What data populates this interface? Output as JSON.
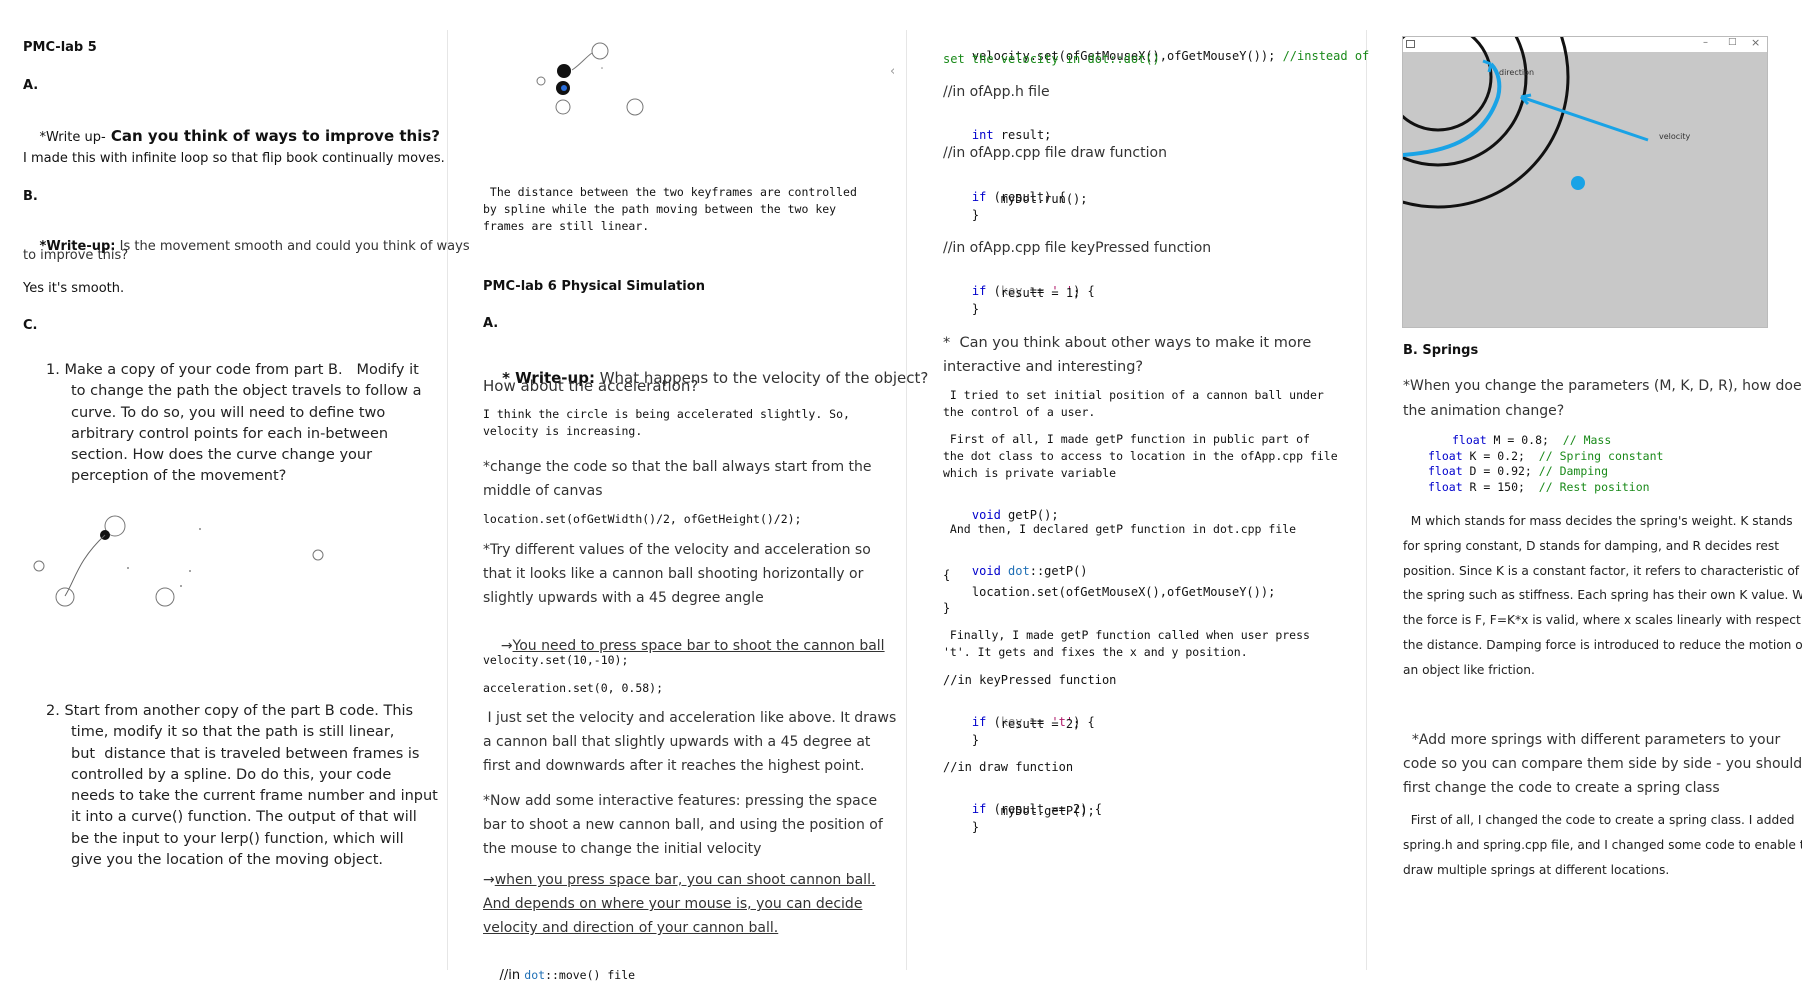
{
  "col1": {
    "title": "PMC-lab 5",
    "a_label": "A.",
    "a_writeup_prefix": "*Write up-",
    "a_writeup_q": " Can you think of ways to improve this?",
    "a_answer": "I made this with infinite loop so that flip book continually moves.",
    "b_label": "B.",
    "b_writeup_prefix": "*Write-up:",
    "b_writeup_q_line1": " Is the movement smooth and could you think of ways",
    "b_writeup_q_line2": "to improve this?",
    "b_answer": "Yes it's smooth.",
    "c_label": "C.",
    "item1_lines": [
      "1. Make a copy of your code from part B.   Modify it",
      "to change the path the object travels to follow a",
      "curve. To do so, you will need to define two",
      "arbitrary control points for each in-between",
      "section. How does the curve change your",
      "perception of the movement?"
    ],
    "item2_lines": [
      "2. Start from another copy of the part B code. This",
      "time, modify it so that the path is still linear,",
      "but  distance that is traveled between frames is",
      "controlled by a spline. Do do this, your code",
      "needs to take the current frame number and input",
      "it into a curve() function. The output of that will",
      "be the input to your lerp() function, which will",
      "give you the location of the moving object."
    ]
  },
  "col2": {
    "spline_note": [
      " The distance between the two keyframes are controlled",
      "by spline while the path moving between the two key",
      "frames are still linear."
    ],
    "lab6_title": "PMC-lab 6 Physical Simulation",
    "a_label": "A.",
    "q1_prefix": "* Write-up:",
    "q1_line1": " What happens to the velocity of the object?",
    "q1_line2": "How about the acceleration?",
    "a1_lines": [
      "I think the circle is being accelerated slightly. So,",
      "velocity is increasing."
    ],
    "q2_lines": [
      "*change the code so that the ball always start from the",
      "middle of canvas"
    ],
    "code_location": "location.set(ofGetWidth()/2, ofGetHeight()/2);",
    "q3_lines": [
      "*Try different values of the velocity and acceleration so",
      "that it looks like a cannon ball shooting horizontally or",
      "slightly upwards with a 45 degree angle"
    ],
    "arrow_note": "You need to press space bar to shoot the cannon ball",
    "code_velocity": "velocity.set(10,-10);",
    "code_accel": "acceleration.set(0, 0.58);",
    "a3_lines": [
      " I just set the velocity and acceleration like above. It draws",
      "a cannon ball that slightly upwards with a 45 degree at",
      "first and downwards after it reaches the highest point."
    ],
    "q4_lines": [
      "*Now add some interactive features: pressing the space",
      "bar to shoot a new cannon ball, and using the position of",
      "the mouse to change the initial velocity"
    ],
    "a4_lines": [
      "when you press space bar, you can shoot cannon ball.",
      "And depends on where your mouse is, you can decide",
      "velocity and direction of your cannon ball."
    ],
    "code_dotmove_prefix": "//in ",
    "code_dotmove_cls": "dot",
    "code_dotmove_rest": "::move() file"
  },
  "col3": {
    "code_vel_a": "velocity.set(ofGetMouseX(),ofGetMouseY()); ",
    "code_vel_cmt_a": "//instead of",
    "code_vel_cmt_b": "set the velocity in dot::dot()",
    "c_apph": "//in ofApp.h file",
    "int_kw": "int",
    "int_rest": " result;",
    "c_appcpp_draw": "//in ofApp.cpp file draw function",
    "if1_line1_kw": "if",
    "if1_line1_rest": " (result) {",
    "if1_line2": "        myDot.run();",
    "if1_line3": "    }",
    "c_keypressed": "//in ofApp.cpp file keyPressed function",
    "if2_kw": "if",
    "if2_key": "key",
    "if2_mid": " == ",
    "if2_str": "' '",
    "if2_end": ") {",
    "if2_line2": "        result = 1;",
    "if2_line3": "    }",
    "q_lines": [
      "*  Can you think about other ways to make it more",
      "interactive and interesting?"
    ],
    "a_lines1": [
      " I tried to set initial position of a cannon ball under",
      "the control of a user."
    ],
    "a_lines2": [
      " First of all, I made getP function in public part of",
      "the dot class to access to location in the ofApp.cpp file",
      "which is private variable"
    ],
    "void1_kw": "void",
    "void1_rest": " getP();",
    "a_line3": " And then, I declared getP function in dot.cpp file",
    "void2_kw": "void",
    "void2_cls": " dot",
    "void2_rest": "::getP()",
    "brace_open": "{",
    "getp_body": "    location.set(ofGetMouseX(),ofGetMouseY());",
    "brace_close": "}",
    "a_lines4": [
      " Finally, I made getP function called when user press",
      "'t'. It gets and fixes the x and y position."
    ],
    "c_keypressed2": "//in keyPressed function",
    "if3_kw": "if",
    "if3_key": "key",
    "if3_mid": " == ",
    "if3_str": "'t'",
    "if3_end": ") {",
    "if3_line2": "        result = 2;",
    "if3_line3": "    }",
    "c_draw": "//in draw function",
    "if4_kw": "if",
    "if4_rest": " (result == 2) {",
    "if4_line2": "        myDot.getP();",
    "if4_line3": "    }"
  },
  "col4": {
    "window_controls": [
      "–",
      "□",
      "×"
    ],
    "label_direction": "direction",
    "label_velocity": "velocity",
    "b_title": "B. Springs",
    "q_lines": [
      "*When you change the parameters (M, K, D, R), how does",
      "the animation change?"
    ],
    "code_lines": [
      {
        "kw": "float",
        "rest": " M = 0.8;  ",
        "cmt": "// Mass"
      },
      {
        "kw": "float",
        "rest": " K = 0.2;  ",
        "cmt": "// Spring constant"
      },
      {
        "kw": "float",
        "rest": " D = 0.92; ",
        "cmt": "// Damping"
      },
      {
        "kw": "float",
        "rest": " R = 150;  ",
        "cmt": "// Rest position"
      }
    ],
    "a_lines": [
      "  M which stands for mass decides the spring's weight. K stands",
      "for spring constant, D stands for damping, and R decides rest",
      "position. Since K is a constant factor, it refers to characteristic of",
      "the spring such as stiffness. Each spring has their own K value. When",
      "the force is F, F=K*x is valid, where x scales linearly with respect to",
      "the distance. Damping force is introduced to reduce the motion of",
      "an object like friction."
    ],
    "q2_lines": [
      "  *Add more springs with different parameters to your",
      "code so you can compare them side by side - you should",
      "first change the code to create a spring class"
    ],
    "a2_lines": [
      "  First of all, I changed the code to create a spring class. I added",
      "spring.h and spring.cpp file, and I changed some code to enable to",
      "draw multiple springs at different locations."
    ],
    "colors": {
      "accent": "#19a3e6",
      "screen_bg": "#c8c8c8"
    }
  }
}
